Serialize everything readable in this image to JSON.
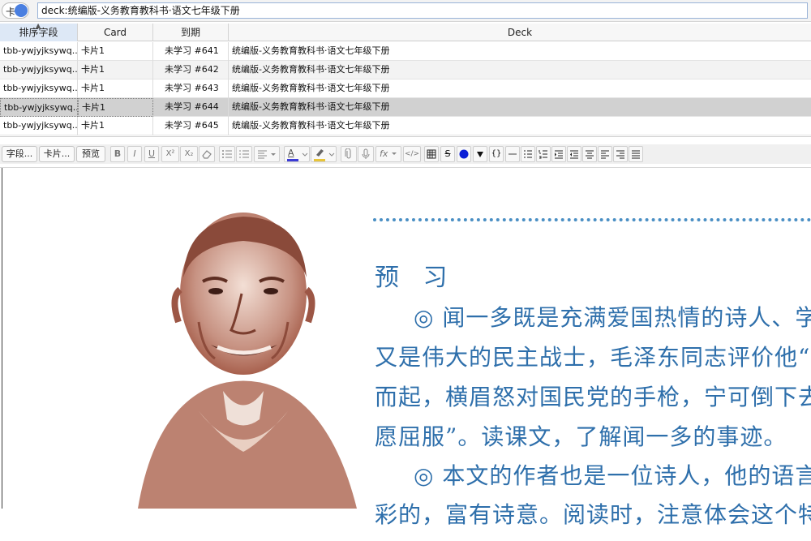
{
  "search": {
    "mode_label": "卡",
    "query": "deck:统编版-义务教育教科书·语文七年级下册"
  },
  "table": {
    "columns": [
      "排序字段",
      "Card",
      "到期",
      "Deck"
    ],
    "rows": [
      {
        "sort_field": "tbb-ywjyjksywq...",
        "card": "卡片1",
        "due": "未学习 #641",
        "deck": "统编版-义务教育教科书·语文七年级下册"
      },
      {
        "sort_field": "tbb-ywjyjksywq...",
        "card": "卡片1",
        "due": "未学习 #642",
        "deck": "统编版-义务教育教科书·语文七年级下册"
      },
      {
        "sort_field": "tbb-ywjyjksywq...",
        "card": "卡片1",
        "due": "未学习 #643",
        "deck": "统编版-义务教育教科书·语文七年级下册"
      },
      {
        "sort_field": "tbb-ywjyjksywq...",
        "card": "卡片1",
        "due": "未学习 #644",
        "deck": "统编版-义务教育教科书·语文七年级下册"
      },
      {
        "sort_field": "tbb-ywjyjksywq...",
        "card": "卡片1",
        "due": "未学习 #645",
        "deck": "统编版-义务教育教科书·语文七年级下册"
      }
    ],
    "selected_row": 3
  },
  "editor": {
    "fields_button": "字段...",
    "cards_button": "卡片...",
    "preview_button": "预览",
    "bold": "B",
    "italic": "I",
    "underline": "U",
    "superscript": "X²",
    "subscript": "X₂",
    "text_color_icon": "A",
    "mathjax_icon": "fx",
    "html_icon": "</>",
    "code_icon": "{}",
    "strike_icon": "S",
    "colors": {
      "circle": "#0b1fd6",
      "accent": "#2e6fab",
      "text_color_bar": "#3c3cd6",
      "highlight_bar": "#e8c53a"
    }
  },
  "page": {
    "title": "预 习",
    "lines": [
      "◎ 闻一多既是充满爱国热情的诗人、学者",
      "又是伟大的民主战士，毛泽东同志评价他“拍",
      "而起，横眉怒对国民党的手枪，宁可倒下去，",
      "愿屈服”。读课文，了解闻一多的事迹。",
      "◎ 本文的作者也是一位诗人，他的语言精",
      "彩的，富有诗意。阅读时，注意体会这个特点"
    ]
  }
}
